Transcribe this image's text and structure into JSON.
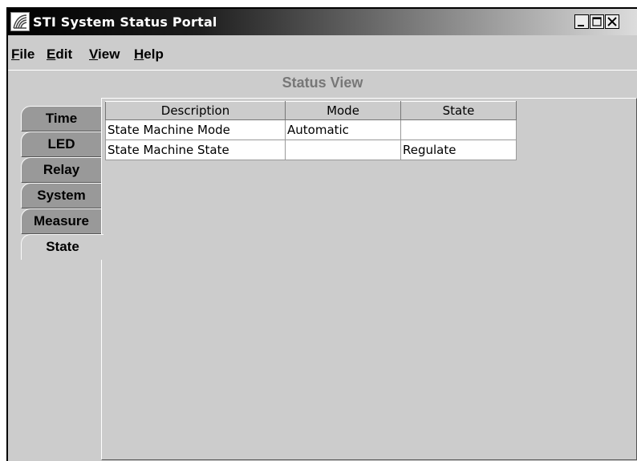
{
  "window": {
    "title": "STI System Status Portal",
    "icon": "sti-logo-icon",
    "controls": {
      "minimize": "_",
      "maximize": "□",
      "close": "X"
    }
  },
  "menubar": {
    "items": [
      "File",
      "Edit",
      "View",
      "Help"
    ]
  },
  "panel": {
    "title": "Status View"
  },
  "tabs": [
    {
      "label": "Time",
      "selected": false
    },
    {
      "label": "LED",
      "selected": false
    },
    {
      "label": "Relay",
      "selected": false
    },
    {
      "label": "System",
      "selected": false
    },
    {
      "label": "Measure",
      "selected": false
    },
    {
      "label": "State",
      "selected": true
    }
  ],
  "table": {
    "columns": [
      "Description",
      "Mode",
      "State"
    ],
    "rows": [
      [
        "State Machine Mode",
        "Automatic",
        ""
      ],
      [
        "State Machine State",
        "",
        "Regulate"
      ]
    ]
  },
  "colors": {
    "window_bg": "#cccccc",
    "tab_inactive": "#999999",
    "tab_active": "#cccccc",
    "panel_title": "#777777",
    "cell_bg": "#ffffff"
  }
}
